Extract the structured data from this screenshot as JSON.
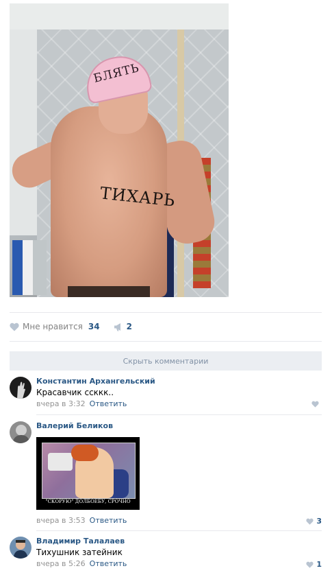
{
  "post": {
    "photo": {
      "cap_text": "БЛЯТЬ",
      "chest_text": "ТИХАРЬ"
    },
    "likes": {
      "label": "Мне нравится",
      "count": "34"
    },
    "shares": {
      "count": "2"
    }
  },
  "comments_toggle": {
    "label": "Скрыть комментарии"
  },
  "comments": [
    {
      "author": "Константин Архангельский",
      "text": "Красавчик ссккк..",
      "time": "вчера в 3:32",
      "reply": "Ответить",
      "likes": ""
    },
    {
      "author": "Валерий Беликов",
      "image_caption": "\"СКОРУЮ\" ДОЛБОЕБУ, СРОЧНО",
      "time": "вчера в 3:53",
      "reply": "Ответить",
      "likes": "3"
    },
    {
      "author": "Владимир Талалаев",
      "text": "Тихушник затейник",
      "time": "вчера в 5:26",
      "reply": "Ответить",
      "likes": "1"
    }
  ],
  "colors": {
    "link": "#2a5885",
    "muted": "#939393",
    "divider": "#e7e8ec",
    "toggle_bg": "#ebeef2",
    "toggle_text": "#8191a5",
    "icon": "#b9c4d1"
  }
}
